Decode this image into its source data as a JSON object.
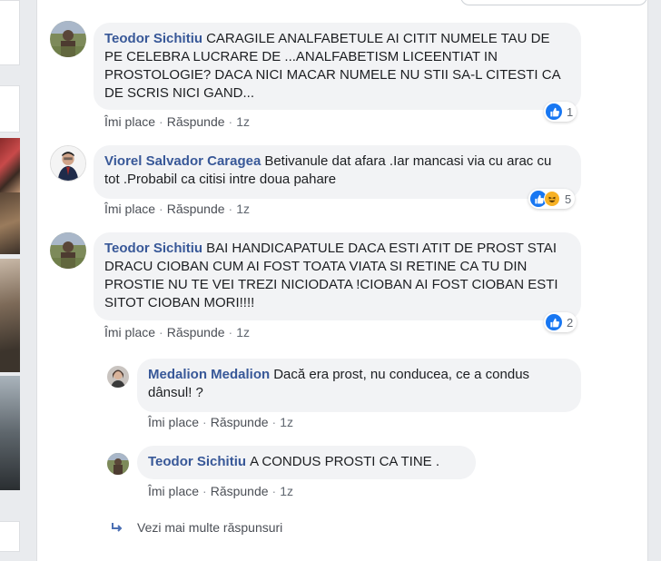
{
  "search": {
    "placeholder": ""
  },
  "comments": [
    {
      "author": "Teodor Sichitiu",
      "text": "CARAGILE ANALFABETULE AI CITIT NUMELE TAU DE PE CELEBRA LUCRARE DE ...ANALFABETISM LICEENTIAT IN PROSTOLOGIE? DACA NICI MACAR NUMELE NU STII SA-L CITESTI CA DE SCRIS NICI GAND...",
      "like_label": "Îmi place",
      "reply_label": "Răspunde",
      "time": "1z",
      "reactions": {
        "icons": [
          "like-icon"
        ],
        "count": "1"
      }
    },
    {
      "author": "Viorel Salvador Caragea",
      "text": "Betivanule dat afara .Iar mancasi via cu arac cu tot .Probabil ca citisi intre doua pahare",
      "like_label": "Îmi place",
      "reply_label": "Răspunde",
      "time": "1z",
      "reactions": {
        "icons": [
          "like-icon",
          "haha-icon"
        ],
        "count": "5"
      }
    },
    {
      "author": "Teodor Sichitiu",
      "text": "BAI HANDICAPATULE DACA ESTI ATIT DE PROST STAI DRACU CIOBAN CUM AI FOST TOATA VIATA SI RETINE CA TU DIN PROSTIE NU TE VEI TREZI NICIODATA !CIOBAN AI FOST CIOBAN ESTI SITOT CIOBAN MORI!!!!",
      "like_label": "Îmi place",
      "reply_label": "Răspunde",
      "time": "1z",
      "reactions": {
        "icons": [
          "like-icon"
        ],
        "count": "2"
      }
    }
  ],
  "replies": [
    {
      "author": "Medalion Medalion",
      "text": "Dacă era prost, nu conducea, ce a condus dânsul! ?",
      "like_label": "Îmi place",
      "reply_label": "Răspunde",
      "time": "1z"
    },
    {
      "author": "Teodor Sichitiu",
      "text": "A CONDUS PROSTI CA TINE .",
      "like_label": "Îmi place",
      "reply_label": "Răspunde",
      "time": "1z"
    }
  ],
  "more_replies_label": "Vezi mai multe răspunsuri",
  "colors": {
    "author": "#385898",
    "bubble": "#f2f3f5",
    "like": "#1877f2",
    "haha": "#f7b125",
    "background": "#e9ebee"
  }
}
